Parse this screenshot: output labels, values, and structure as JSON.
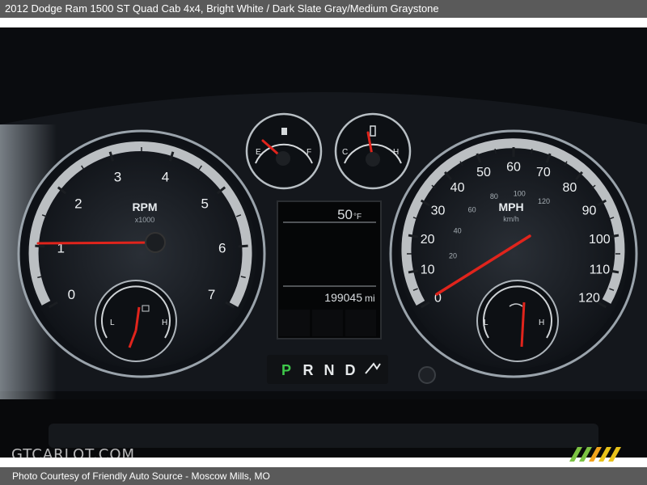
{
  "caption": {
    "title": "2012 Dodge Ram 1500 ST Quad Cab 4x4,  Bright White / Dark Slate Gray/Medium Graystone",
    "credit": "Photo Courtesy of Friendly Auto Source - Moscow Mills, MO"
  },
  "watermark": "GTCARLOT.COM",
  "cluster": {
    "tach": {
      "label": "RPM",
      "unit": "x1000",
      "ticks": [
        "0",
        "1",
        "2",
        "3",
        "4",
        "5",
        "6",
        "7"
      ]
    },
    "speedo": {
      "label": "MPH",
      "unit": "km/h",
      "mph_ticks": [
        "0",
        "10",
        "20",
        "30",
        "40",
        "50",
        "60",
        "70",
        "80",
        "90",
        "100",
        "110",
        "120"
      ],
      "kmh_ticks": [
        "20",
        "40",
        "60",
        "80",
        "100",
        "120"
      ]
    },
    "fuel": {
      "empty": "E",
      "full": "F"
    },
    "temp": {
      "cold": "C",
      "hot": "H"
    },
    "small_left": {
      "low": "L",
      "high": "H"
    },
    "small_right": {
      "low": "L",
      "high": "H"
    },
    "display": {
      "temperature": "50",
      "temp_unit": "°F",
      "odometer": "199045",
      "odo_unit": "mi"
    },
    "gear": {
      "P": "P",
      "R": "R",
      "N": "N",
      "D": "D"
    }
  },
  "colors": {
    "needle": "#e0241c",
    "gear_active": "#3ec84a",
    "stripes": [
      "#7cc243",
      "#f2a31c",
      "#e8c21a",
      "#7cc243"
    ]
  }
}
